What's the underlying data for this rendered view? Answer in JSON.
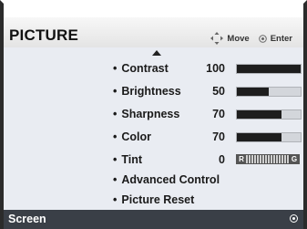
{
  "menu": {
    "title": "PICTURE",
    "hint_move": "Move",
    "hint_enter": "Enter"
  },
  "items": [
    {
      "label": "Contrast",
      "value": "100",
      "level": 1.0
    },
    {
      "label": "Brightness",
      "value": "50",
      "level": 0.5
    },
    {
      "label": "Sharpness",
      "value": "70",
      "level": 0.7
    },
    {
      "label": "Color",
      "value": "70",
      "level": 0.7
    },
    {
      "label": "Tint",
      "value": "0",
      "tint_left": "R",
      "tint_right": "G"
    },
    {
      "label": "Advanced Control"
    },
    {
      "label": "Picture Reset"
    }
  ],
  "footer": {
    "selected_label": "Screen"
  }
}
